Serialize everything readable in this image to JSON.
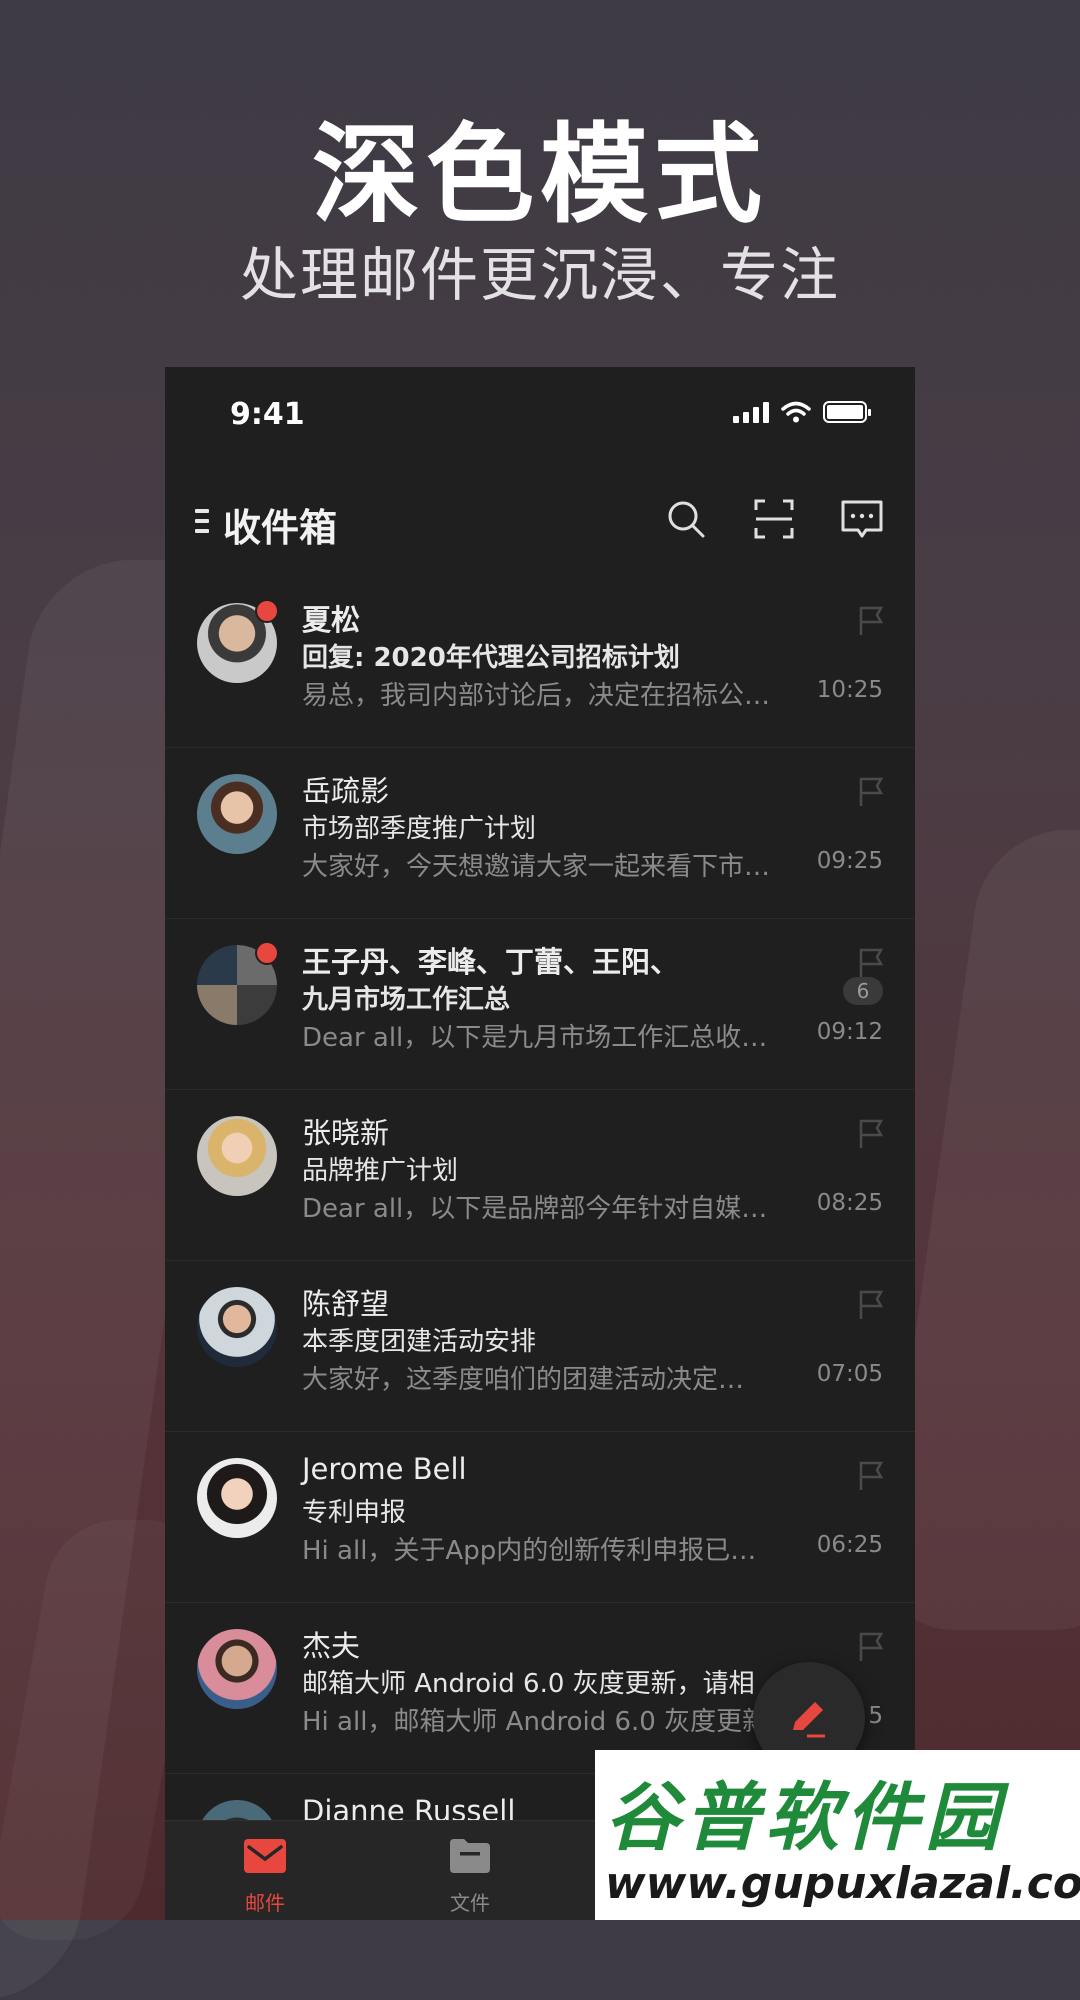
{
  "hero": {
    "title": "深色模式",
    "subtitle": "处理邮件更沉浸、专注"
  },
  "status_bar": {
    "time": "9:41"
  },
  "header": {
    "title": "收件箱",
    "icons": [
      "menu-icon",
      "search-icon",
      "scan-icon",
      "chat-icon"
    ]
  },
  "mails": [
    {
      "sender": "夏松",
      "subject": "回复: 2020年代理公司招标计划",
      "preview": "易总，我司内部讨论后，决定在招标公…",
      "time": "10:25",
      "unread": true,
      "bold": true
    },
    {
      "sender": "岳疏影",
      "subject": "市场部季度推广计划",
      "preview": "大家好，今天想邀请大家一起来看下市…",
      "time": "09:25",
      "unread": false,
      "bold": false
    },
    {
      "sender": "王子丹、李峰、丁蕾、王阳、",
      "subject": "九月市场工作汇总",
      "preview": "Dear all，以下是九月市场工作汇总收…",
      "time": "09:12",
      "unread": true,
      "bold": true,
      "count": "6"
    },
    {
      "sender": "张晓新",
      "subject": "品牌推广计划",
      "preview": "Dear all，以下是品牌部今年针对自媒…",
      "time": "08:25",
      "unread": false,
      "bold": false
    },
    {
      "sender": "陈舒望",
      "subject": "本季度团建活动安排",
      "preview": "大家好，这季度咱们的团建活动决定…",
      "time": "07:05",
      "unread": false,
      "bold": false
    },
    {
      "sender": "Jerome Bell",
      "subject": "专利申报",
      "preview": "Hi all，关于App内的创新传利申报已…",
      "time": "06:25",
      "unread": false,
      "bold": false
    },
    {
      "sender": "杰夫",
      "subject": "邮箱大师 Android 6.0 灰度更新，请相",
      "preview": "Hi all，邮箱大师 Android 6.0 灰度更新",
      "time": "5",
      "unread": false,
      "bold": false
    },
    {
      "sender": "Dianne Russell",
      "subject": "",
      "preview": "",
      "time": "",
      "unread": false,
      "bold": false
    }
  ],
  "tabs": [
    {
      "label": "邮件",
      "icon": "mail-icon",
      "active": true
    },
    {
      "label": "文件",
      "icon": "folder-icon",
      "active": false
    }
  ],
  "watermark": {
    "top": "谷普软件园",
    "bottom": "www.gupuxlazal.com"
  },
  "colors": {
    "accent": "#e8473f",
    "phone_bg": "#1f1f1f",
    "muted_text": "#8a8a8a"
  }
}
